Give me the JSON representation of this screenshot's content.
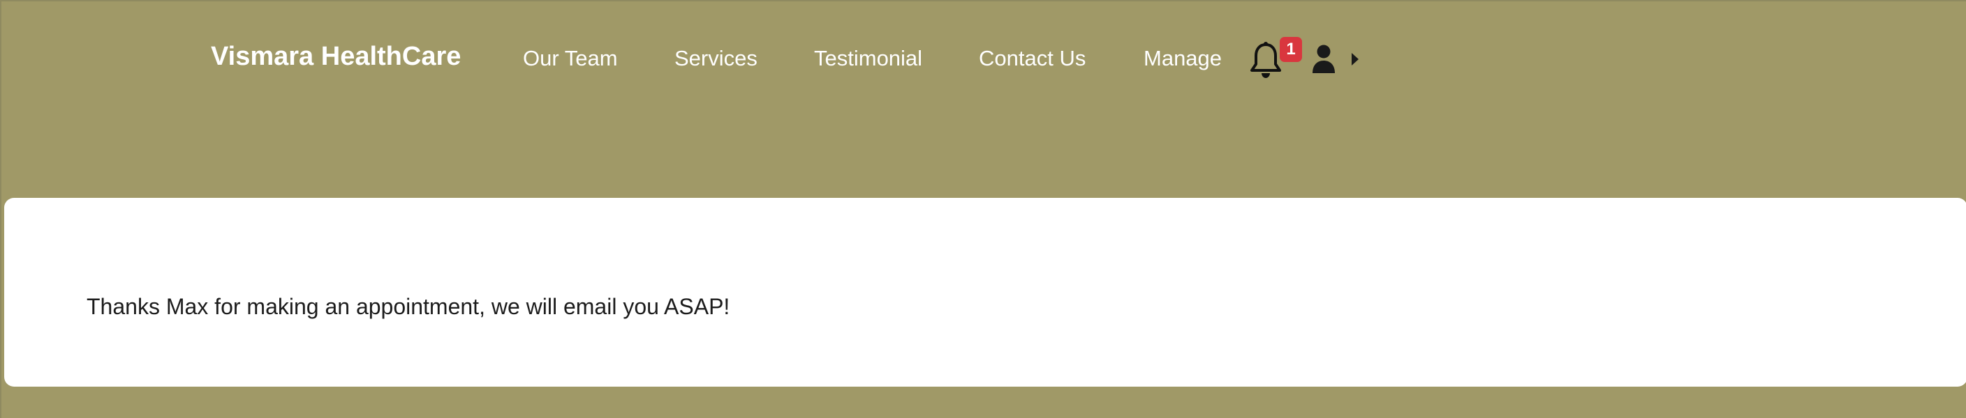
{
  "navbar": {
    "brand": "Vismara HealthCare",
    "links": [
      {
        "label": "Our Team"
      },
      {
        "label": "Services"
      },
      {
        "label": "Testimonial"
      },
      {
        "label": "Contact Us"
      },
      {
        "label": "Manage"
      }
    ],
    "notifications": {
      "icon": "bell-icon",
      "count": "1"
    },
    "user_menu": {
      "icon": "user-icon",
      "dropdown_icon": "caret-right-icon"
    }
  },
  "main": {
    "message": "Thanks Max for making an appointment, we will email you ASAP!"
  },
  "colors": {
    "background": "#a09967",
    "card": "#ffffff",
    "badge": "#d9363e",
    "nav_text": "#ffffff"
  }
}
